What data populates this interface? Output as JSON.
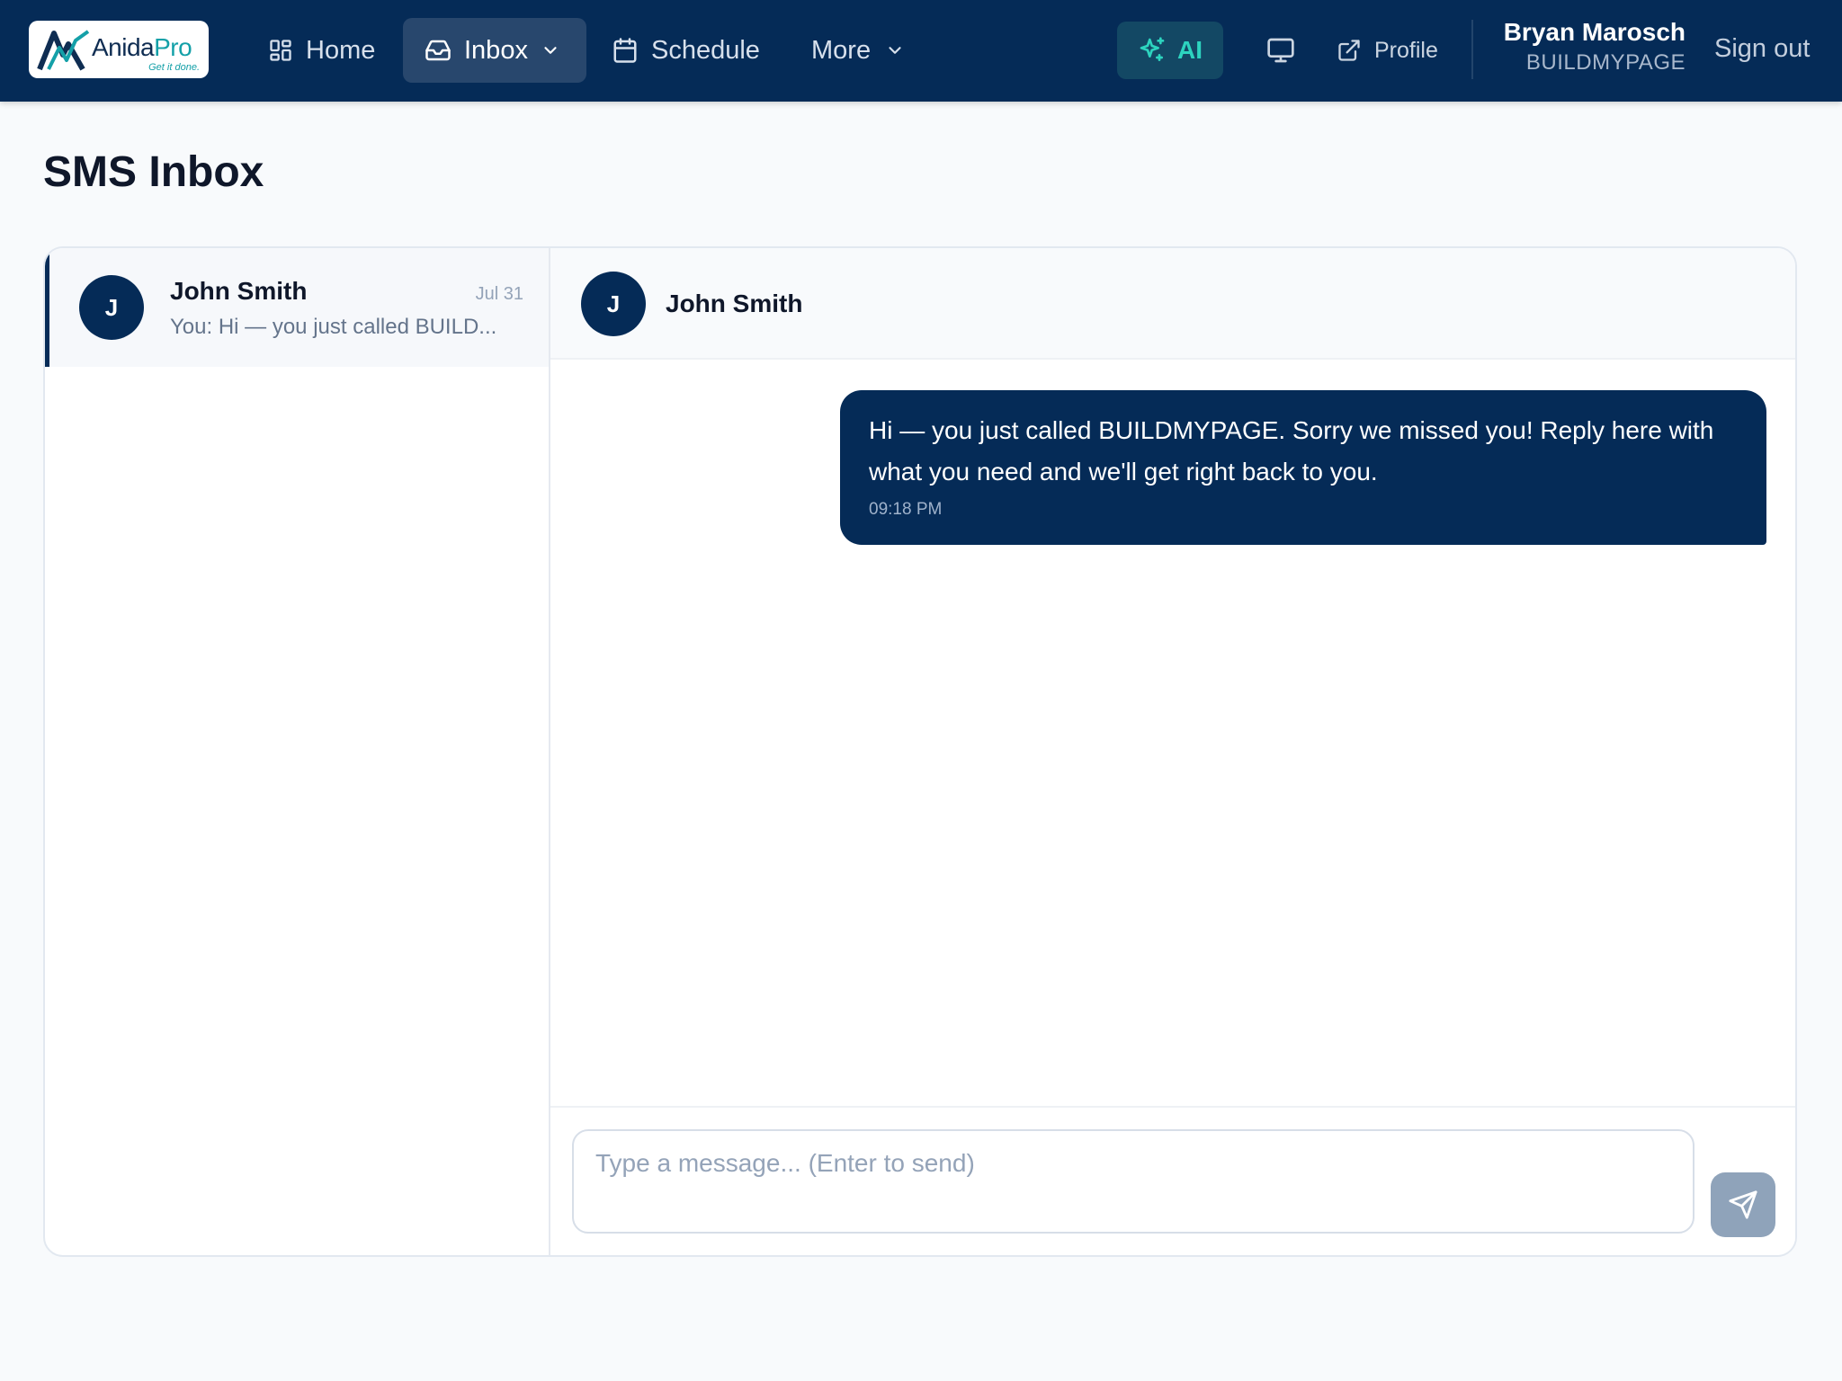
{
  "brand": {
    "name_part1": "Anida",
    "name_part2": "Pro",
    "tagline": "Get it done."
  },
  "nav": {
    "home": "Home",
    "inbox": "Inbox",
    "schedule": "Schedule",
    "more": "More",
    "ai": "AI",
    "profile": "Profile",
    "sign_out": "Sign out"
  },
  "user": {
    "name": "Bryan Marosch",
    "org": "BUILDMYPAGE"
  },
  "page": {
    "title": "SMS Inbox"
  },
  "conversations": [
    {
      "initial": "J",
      "name": "John Smith",
      "date": "Jul 31",
      "preview": "You: Hi — you just called BUILD..."
    }
  ],
  "thread": {
    "initial": "J",
    "name": "John Smith",
    "messages": [
      {
        "text": "Hi — you just called BUILDMYPAGE. Sorry we missed you! Reply here with what you need and we'll get right back to you.",
        "time": "09:18 PM",
        "direction": "outgoing"
      }
    ]
  },
  "composer": {
    "placeholder": "Type a message... (Enter to send)",
    "value": ""
  },
  "colors": {
    "navy": "#052b57",
    "accent_teal": "#2dd4bf",
    "background": "#f8fafc"
  },
  "icons": {
    "home": "grid-icon",
    "inbox": "inbox-tray-icon",
    "schedule": "calendar-icon",
    "more": "chevron-down-icon",
    "ai": "sparkles-icon",
    "screen": "monitor-icon",
    "profile": "external-link-icon",
    "send": "send-icon"
  }
}
